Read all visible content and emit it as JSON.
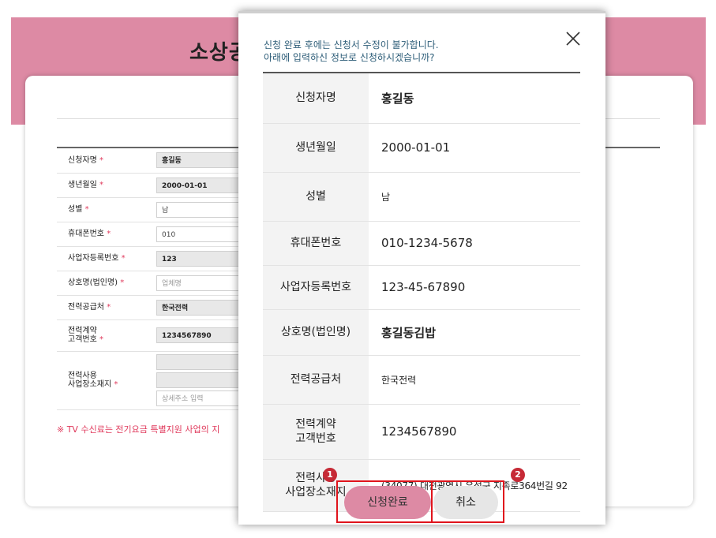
{
  "background": {
    "title": "소상공",
    "form_rows": [
      {
        "label": "신청자명",
        "value": "홍길동",
        "style": "filled"
      },
      {
        "label": "생년월일",
        "value": "2000-01-01",
        "style": "filled"
      },
      {
        "label": "성별",
        "value": "남",
        "style": "plain"
      },
      {
        "label": "휴대폰번호",
        "value": "010",
        "style": "plain"
      },
      {
        "label": "사업자등록번호",
        "value": "123",
        "style": "filled"
      },
      {
        "label": "상호명(법인명)",
        "value": "업체명",
        "style": "ph"
      },
      {
        "label": "전력공급처",
        "value": "한국전력",
        "style": "filled"
      },
      {
        "label": "전력계약\n고객번호",
        "value": "1234567890",
        "style": "filled"
      }
    ],
    "address_label": "전력사용\n사업장소재지",
    "address_detail_placeholder": "상세주소 입력",
    "required_mark": "*",
    "notice": "※ TV 수신료는 전기요금 특별지원 사업의 지"
  },
  "modal": {
    "message_line1": "신청 완료 후에는 신청서 수정이 불가합니다.",
    "message_line2": "아래에 입력하신 정보로 신청하시겠습니까?",
    "close_icon": "close-icon",
    "rows": [
      {
        "label": "신청자명",
        "value": "홍길동"
      },
      {
        "label": "생년월일",
        "value": "2000-01-01"
      },
      {
        "label": "성별",
        "value": "남"
      },
      {
        "label": "휴대폰번호",
        "value": "010-1234-5678"
      },
      {
        "label": "사업자등록번호",
        "value": "123-45-67890"
      },
      {
        "label": "상호명(법인명)",
        "value": "홍길동김밥"
      },
      {
        "label": "전력공급처",
        "value": "한국전력"
      },
      {
        "label": "전력계약\n고객번호",
        "value": "1234567890"
      },
      {
        "label": "전력사용\n사업장소재지",
        "value": "(34077) 대전광역시 유성구 지족로364번길 92"
      }
    ],
    "confirm_label": "신청완료",
    "cancel_label": "취소",
    "badge_1": "1",
    "badge_2": "2"
  },
  "colors": {
    "brand_pink": "#dd8aa4",
    "message_text": "#2d5d78",
    "required_red": "#e03a5c",
    "highlight_red": "#e0141c",
    "badge_red": "#c62a36"
  }
}
